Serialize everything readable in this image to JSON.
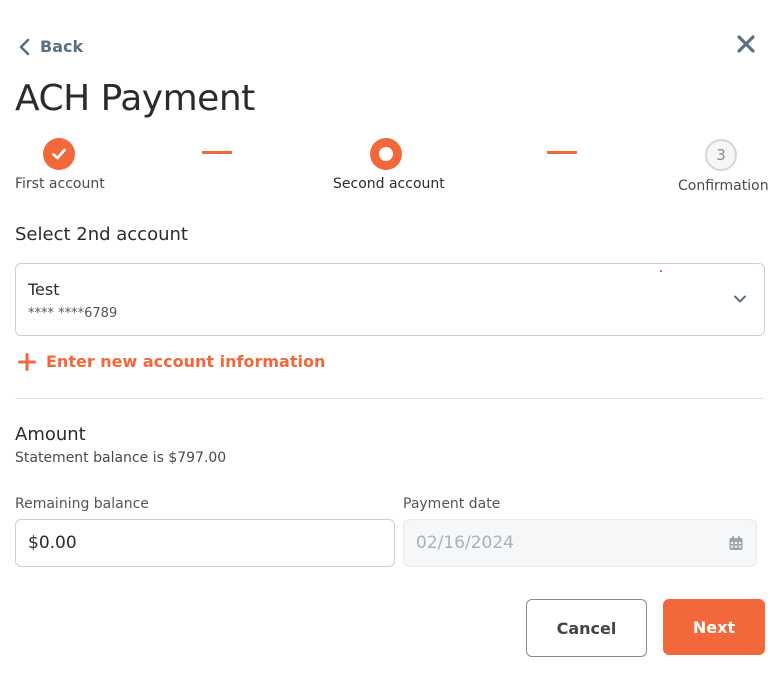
{
  "header": {
    "back_label": "Back",
    "title": "ACH Payment"
  },
  "steps": [
    {
      "number": "1",
      "label": "First account",
      "state": "complete"
    },
    {
      "number": "2",
      "label": "Second account",
      "state": "current"
    },
    {
      "number": "3",
      "label": "Confirmation",
      "state": "upcoming"
    }
  ],
  "select_section": {
    "heading": "Select 2nd account",
    "selected_account": {
      "name": "Test",
      "number": "**** ****6789"
    },
    "add_account_label": "Enter new account information"
  },
  "amount_section": {
    "heading": "Amount",
    "statement_text": "Statement balance is $797.00",
    "remaining_label": "Remaining balance",
    "remaining_value": "$0.00",
    "date_label": "Payment date",
    "date_value": "02/16/2024"
  },
  "actions": {
    "cancel_label": "Cancel",
    "next_label": "Next"
  },
  "colors": {
    "accent": "#f2683a",
    "muted_icon": "#5a6f80"
  }
}
